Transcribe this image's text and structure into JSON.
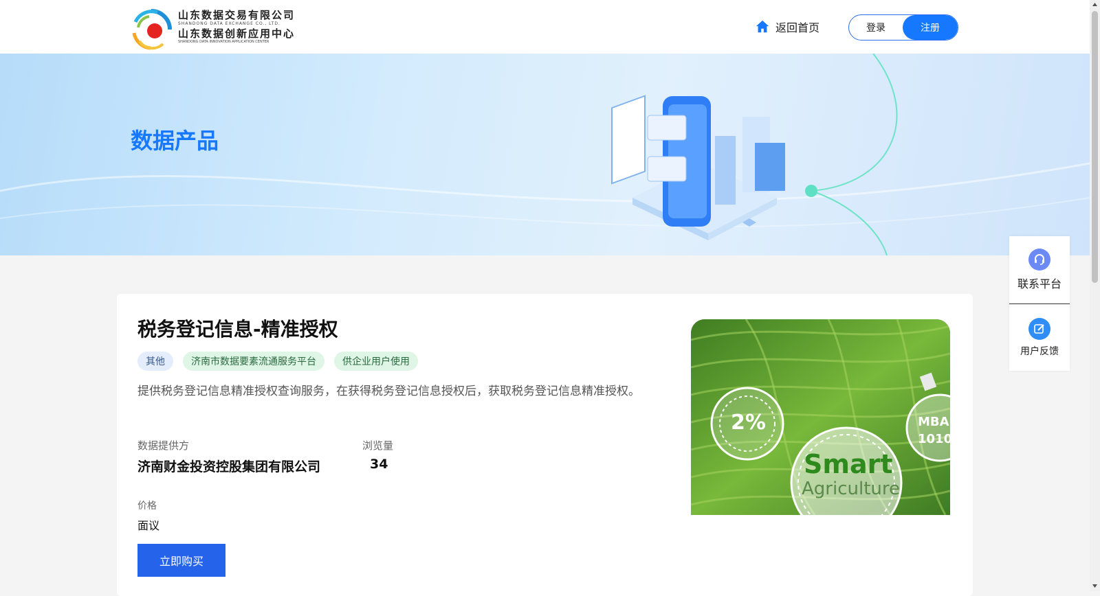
{
  "header": {
    "logo": {
      "line1": "山东数据交易有限公司",
      "line1_en": "SHANDONG DATA EXCHANGE CO., LTD.",
      "line2": "山东数据创新应用中心",
      "line2_en": "SHANDONG DATA INNOVATION APPLICATION CENTER"
    },
    "home_label": "返回首页",
    "login_label": "登录",
    "register_label": "注册"
  },
  "banner": {
    "title": "数据产品"
  },
  "product": {
    "title": "税务登记信息-精准授权",
    "tags": [
      "其他",
      "济南市数据要素流通服务平台",
      "供企业用户使用"
    ],
    "description": "提供税务登记信息精准授权查询服务，在获得税务登记信息授权后，获取税务登记信息精准授权。",
    "provider_label": "数据提供方",
    "provider_value": "济南财金投资控股集团有限公司",
    "views_label": "浏览量",
    "views_value": "34",
    "price_label": "价格",
    "price_value": "面议",
    "buy_label": "立即购买",
    "image_text": {
      "percent": "2%",
      "smart": "Smart",
      "agriculture": "Agriculture",
      "mba": "MBA",
      "mba_num": "1010"
    }
  },
  "side_panel": {
    "contact_label": "联系平台",
    "feedback_label": "用户反馈"
  },
  "colors": {
    "brand_blue": "#1677ff",
    "button_blue": "#2563eb",
    "tag_green_bg": "#dff5e6",
    "tag_blue_bg": "#e3edfb"
  }
}
